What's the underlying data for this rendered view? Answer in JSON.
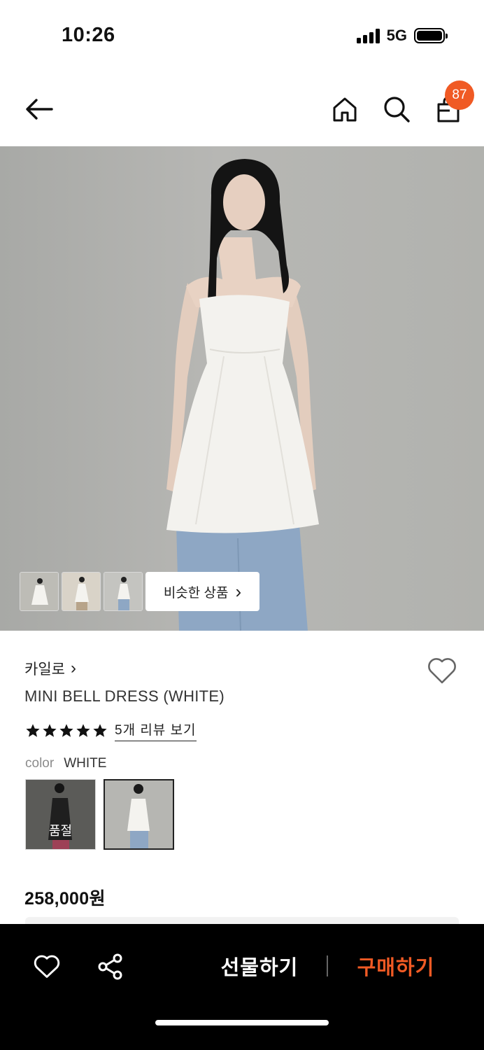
{
  "status_bar": {
    "time": "10:26",
    "network": "5G"
  },
  "nav": {
    "back_icon": "arrow-left-icon",
    "home_icon": "home-icon",
    "search_icon": "search-icon",
    "cart_icon": "shopping-bag-icon",
    "cart_badge": "87"
  },
  "gallery": {
    "thumbnails": [
      "thumbnail-1",
      "thumbnail-2",
      "thumbnail-3"
    ],
    "similar_label": "비슷한 상품",
    "similar_chevron": "›"
  },
  "product": {
    "brand": "카일로",
    "brand_chevron": "›",
    "name": "MINI BELL DRESS (WHITE)",
    "rating": 5,
    "review_link": "5개 리뷰 보기",
    "color_label": "color",
    "color_value": "WHITE",
    "options": [
      {
        "name": "black",
        "soldout_label": "품절"
      },
      {
        "name": "white",
        "selected": true
      }
    ],
    "price": "258,000원"
  },
  "bottom_bar": {
    "gift_label": "선물하기",
    "buy_label": "구매하기"
  },
  "colors": {
    "accent": "#f05a24",
    "bar": "#000000"
  }
}
